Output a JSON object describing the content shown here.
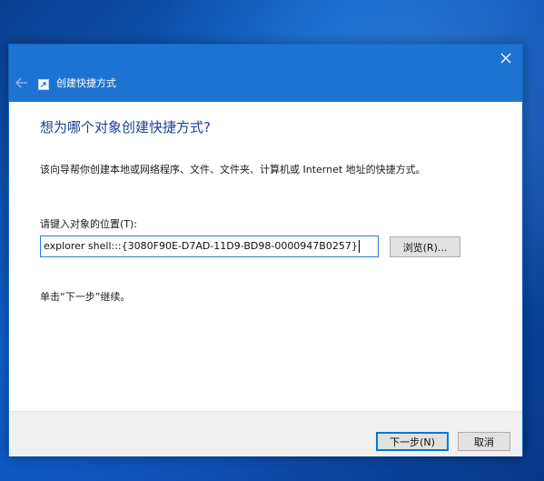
{
  "window": {
    "title": "创建快捷方式",
    "close_icon": "close-icon",
    "back_icon": "back-arrow-icon",
    "wizard_icon": "shortcut-icon"
  },
  "page": {
    "heading": "想为哪个对象创建快捷方式?",
    "description": "该向导帮你创建本地或网络程序、文件、文件夹、计算机或 Internet 地址的快捷方式。",
    "location_label": "请键入对象的位置(T):",
    "location_value": "explorer shell:::{3080F90E-D7AD-11D9-BD98-0000947B0257}",
    "browse_label": "浏览(R)...",
    "hint": "单击“下一步”继续。"
  },
  "footer": {
    "next_label": "下一步(N)",
    "cancel_label": "取消"
  },
  "colors": {
    "titlebar": "#1e73d2",
    "heading": "#1c3f94",
    "accent": "#0078d7"
  }
}
